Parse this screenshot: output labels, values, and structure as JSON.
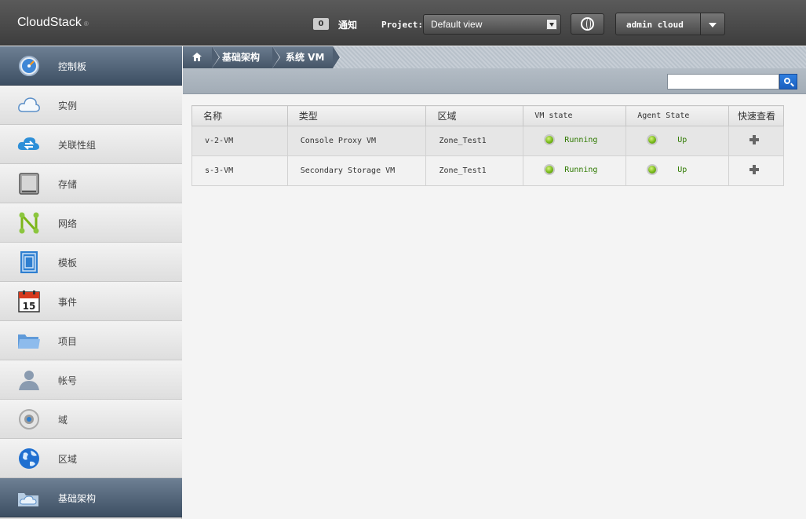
{
  "header": {
    "logo": "CloudStack",
    "logo_mark": "®",
    "notification_count": "0",
    "notification_label": "通知",
    "project_label": "Project:",
    "project_value": "Default view",
    "user": "admin cloud"
  },
  "sidebar": {
    "items": [
      {
        "label": "控制板",
        "icon": "dashboard-icon",
        "active": true
      },
      {
        "label": "实例",
        "icon": "cloud-icon"
      },
      {
        "label": "关联性组",
        "icon": "affinity-group-icon"
      },
      {
        "label": "存储",
        "icon": "storage-icon"
      },
      {
        "label": "网络",
        "icon": "network-icon"
      },
      {
        "label": "模板",
        "icon": "template-icon"
      },
      {
        "label": "事件",
        "icon": "calendar-icon",
        "calendar_day": "15"
      },
      {
        "label": "项目",
        "icon": "folder-icon"
      },
      {
        "label": "帐号",
        "icon": "account-icon"
      },
      {
        "label": "域",
        "icon": "domain-icon"
      },
      {
        "label": "区域",
        "icon": "globe-icon"
      },
      {
        "label": "基础架构",
        "icon": "infrastructure-icon",
        "active": true
      }
    ]
  },
  "breadcrumb": {
    "items": [
      "基础架构",
      "系统 VM"
    ]
  },
  "search": {
    "placeholder": ""
  },
  "table": {
    "columns": [
      "名称",
      "类型",
      "区域",
      "VM state",
      "Agent State",
      "快速查看"
    ],
    "rows": [
      {
        "name": "v-2-VM",
        "type": "Console Proxy VM",
        "zone": "Zone_Test1",
        "vm_state": "Running",
        "agent_state": "Up"
      },
      {
        "name": "s-3-VM",
        "type": "Secondary Storage VM",
        "zone": "Zone_Test1",
        "vm_state": "Running",
        "agent_state": "Up"
      }
    ]
  },
  "colors": {
    "header": "#4a4a4a",
    "active_nav": "#4f6073",
    "status_green": "#76b81a",
    "search_blue": "#2a6fd0"
  }
}
